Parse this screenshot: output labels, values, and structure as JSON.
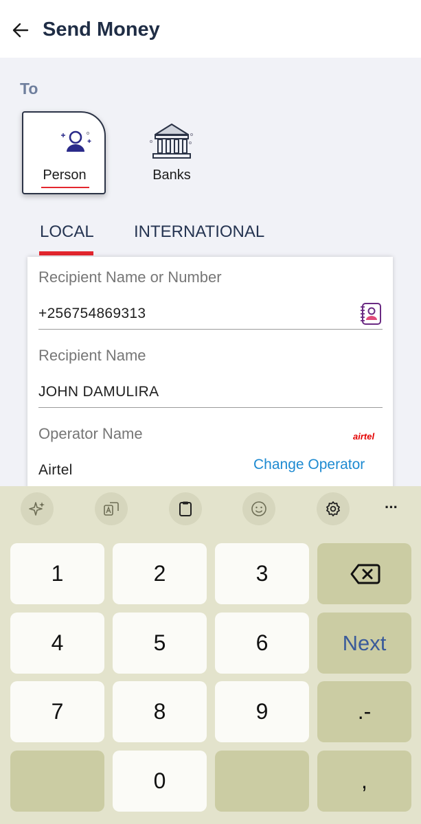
{
  "header": {
    "title": "Send Money",
    "back_icon": "arrow-left-icon"
  },
  "to_section": {
    "label": "To",
    "options": [
      {
        "label": "Person",
        "icon": "person-icon",
        "selected": true
      },
      {
        "label": "Banks",
        "icon": "bank-icon",
        "selected": false
      }
    ]
  },
  "tabs": [
    {
      "label": "LOCAL",
      "active": true
    },
    {
      "label": "INTERNATIONAL",
      "active": false
    }
  ],
  "form": {
    "recipient_number": {
      "label": "Recipient Name or Number",
      "value": "+256754869313",
      "icon": "contacts-book-icon"
    },
    "recipient_name": {
      "label": "Recipient Name",
      "value": "JOHN DAMULIRA"
    },
    "operator": {
      "label": "Operator Name",
      "value": "Airtel",
      "logo_text": "airtel",
      "change_label": "Change Operator"
    }
  },
  "keyboard": {
    "toolbar": [
      "sparkle-icon",
      "translate-icon",
      "clipboard-icon",
      "emoji-icon",
      "settings-icon",
      "more-icon"
    ],
    "more_label": "···",
    "keys": {
      "k1": "1",
      "k2": "2",
      "k3": "3",
      "k4": "4",
      "k5": "5",
      "k6": "6",
      "k7": "7",
      "k8": "8",
      "k9": "9",
      "k0": "0",
      "next": "Next",
      "dot_dash": ".-",
      "comma": ","
    }
  },
  "colors": {
    "accent": "#e3262e",
    "link": "#1d8ad1",
    "title": "#1f2d45",
    "keyboard_bg": "#e3e3cc"
  }
}
